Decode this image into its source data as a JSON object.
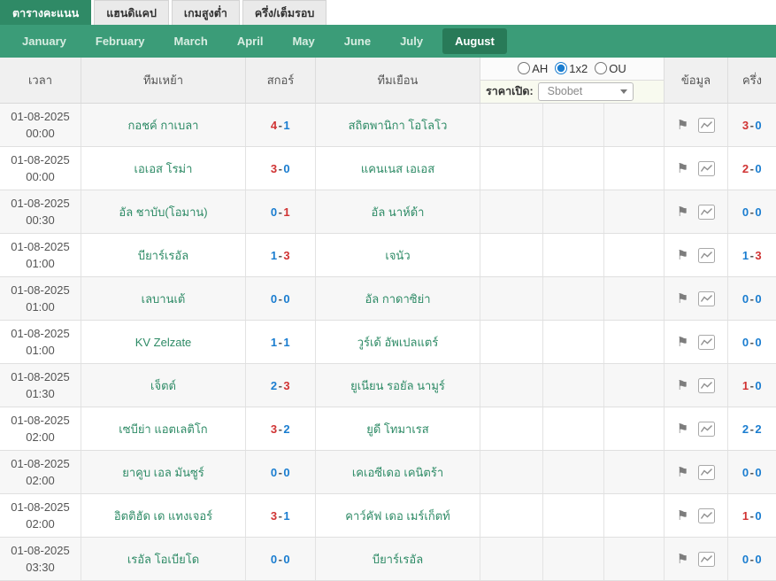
{
  "tabs": [
    {
      "label": "ตารางคะแนน",
      "active": true
    },
    {
      "label": "แฮนดิแคป",
      "active": false
    },
    {
      "label": "เกมสูงต่ำ",
      "active": false
    },
    {
      "label": "ครึ่ง/เต็มรอบ",
      "active": false
    }
  ],
  "months": [
    "January",
    "February",
    "March",
    "April",
    "May",
    "June",
    "July",
    "August"
  ],
  "active_month": "August",
  "table": {
    "headers": {
      "time": "เวลา",
      "home": "ทีมเหย้า",
      "score": "สกอร์",
      "away": "ทีมเยือน",
      "odds_types": [
        "AH",
        "1x2",
        "OU"
      ],
      "odds_selected": "1x2",
      "price_label": "ราคาเปิด:",
      "bookmaker": "Sbobet",
      "info": "ข้อมูล",
      "half": "ครึ่ง"
    },
    "icons": {
      "info_flag": "flag-icon",
      "info_chart": "chart-icon"
    },
    "rows": [
      {
        "date": "01-08-2025",
        "time": "00:00",
        "home": "กอชค์ กาเบลา",
        "score": [
          "4",
          "1"
        ],
        "away": "สถิตพานิกา โอโลโว",
        "half": [
          "3",
          "0"
        ]
      },
      {
        "date": "01-08-2025",
        "time": "00:00",
        "home": "เอเอส โรม่า",
        "score": [
          "3",
          "0"
        ],
        "away": "แคนเนส เอเอส",
        "half": [
          "2",
          "0"
        ]
      },
      {
        "date": "01-08-2025",
        "time": "00:30",
        "home": "อัล ชาบับ(โอมาน)",
        "score": [
          "0",
          "1"
        ],
        "away": "อัล นาห์ด้า",
        "half": [
          "0",
          "0"
        ]
      },
      {
        "date": "01-08-2025",
        "time": "01:00",
        "home": "บียาร์เรอัล",
        "score": [
          "1",
          "3"
        ],
        "away": "เจนัว",
        "half": [
          "1",
          "3"
        ]
      },
      {
        "date": "01-08-2025",
        "time": "01:00",
        "home": "เลบานเต้",
        "score": [
          "0",
          "0"
        ],
        "away": "อัล กาดาซิย่า",
        "half": [
          "0",
          "0"
        ]
      },
      {
        "date": "01-08-2025",
        "time": "01:00",
        "home": "KV Zelzate",
        "score": [
          "1",
          "1"
        ],
        "away": "วูร์เด้ อัพเปลแตร์",
        "half": [
          "0",
          "0"
        ]
      },
      {
        "date": "01-08-2025",
        "time": "01:30",
        "home": "เจ็ตต์",
        "score": [
          "2",
          "3"
        ],
        "away": "ยูเนียน รอยัล นามูร์",
        "half": [
          "1",
          "0"
        ]
      },
      {
        "date": "01-08-2025",
        "time": "02:00",
        "home": "เซบีย่า แอตเลติโก",
        "score": [
          "3",
          "2"
        ],
        "away": "ยูดี โทมาเรส",
        "half": [
          "2",
          "2"
        ]
      },
      {
        "date": "01-08-2025",
        "time": "02:00",
        "home": "ยาคูบ เอล มันซูร์",
        "score": [
          "0",
          "0"
        ],
        "away": "เคเอซีเดอ เคนิตร้า",
        "half": [
          "0",
          "0"
        ]
      },
      {
        "date": "01-08-2025",
        "time": "02:00",
        "home": "อิตติฮัด เด แทงเจอร์",
        "score": [
          "3",
          "1"
        ],
        "away": "คาว์คัฟ เดอ เมร์เก็ตท์",
        "half": [
          "1",
          "0"
        ]
      },
      {
        "date": "01-08-2025",
        "time": "03:30",
        "home": "เรอัล โอเบียโด",
        "score": [
          "0",
          "0"
        ],
        "away": "บียาร์เรอัล",
        "half": [
          "0",
          "0"
        ]
      }
    ]
  },
  "colors": {
    "accent_green": "#3B9C78",
    "active_pill_green": "#287A58",
    "score_win_red": "#D03333",
    "score_blue": "#1A7DD0",
    "team_green": "#2E8B66"
  }
}
